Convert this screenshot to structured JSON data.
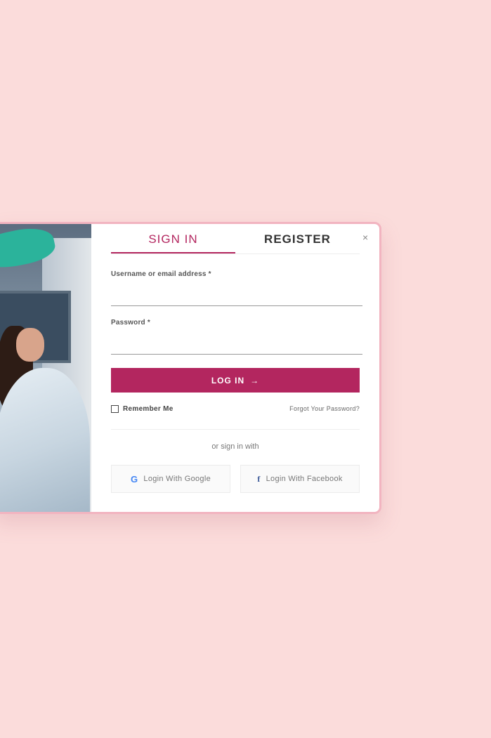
{
  "modal": {
    "close_label": "×",
    "tabs": [
      {
        "label": "SIGN IN",
        "active": true
      },
      {
        "label": "REGISTER",
        "active": false
      }
    ],
    "username": {
      "label": "Username or email address *",
      "value": "",
      "placeholder": ""
    },
    "password": {
      "label": "Password *",
      "value": "",
      "placeholder": ""
    },
    "login_button": {
      "label": "LOG IN",
      "arrow": "→"
    },
    "remember_me": {
      "label": "Remember Me",
      "checked": false
    },
    "forgot_password": "Forgot Your Password?",
    "or_text": "or sign in with",
    "social": [
      {
        "label": "Login With Google",
        "icon": "google-icon"
      },
      {
        "label": "Login With Facebook",
        "icon": "facebook-icon"
      }
    ]
  },
  "colors": {
    "background": "#fbdcdb",
    "accent": "#b3265f",
    "modal_border": "#f2b4c0"
  }
}
